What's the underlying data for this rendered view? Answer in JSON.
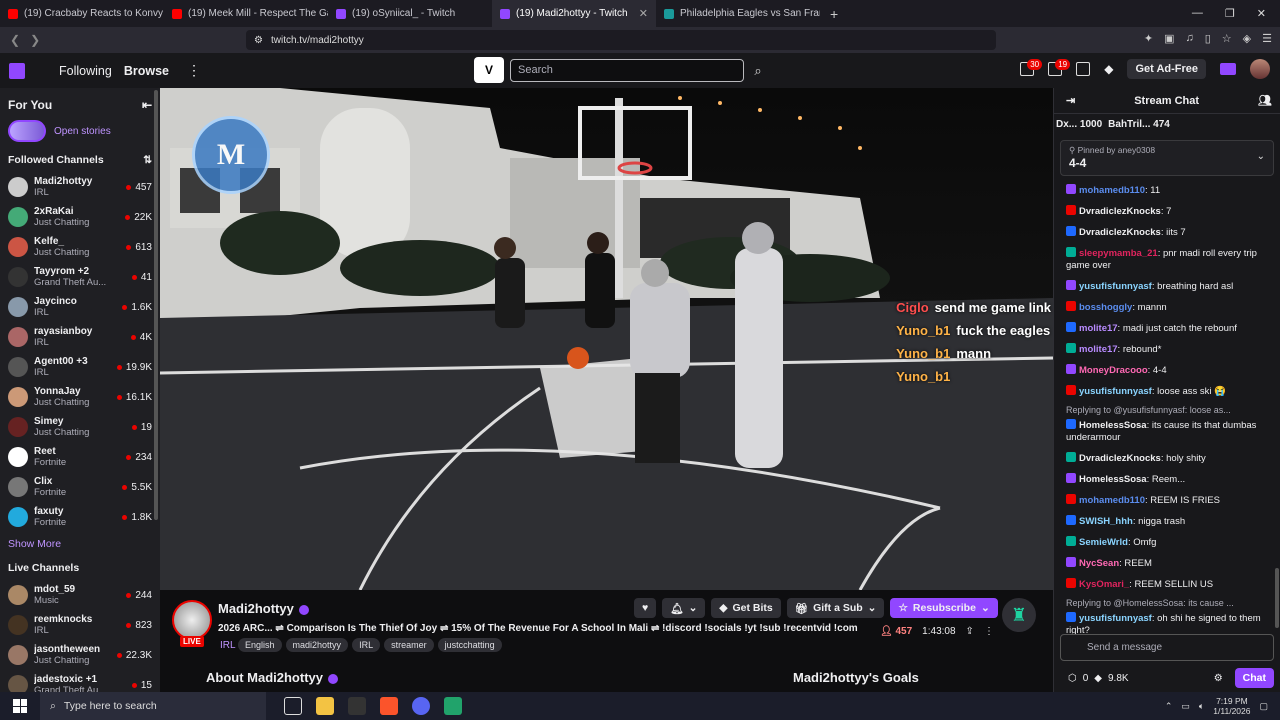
{
  "browser": {
    "tabs": [
      {
        "title": "(19) Cracbaby Reacts to Konvy Nearly...",
        "color": "#ff0000"
      },
      {
        "title": "(19) Meek Mill - Respect The Game [Of...",
        "color": "#ff0000"
      },
      {
        "title": "(19) oSyniical_ - Twitch",
        "color": "#9147ff"
      },
      {
        "title": "(19) Madi2hottyy - Twitch",
        "color": "#9147ff"
      },
      {
        "title": "Philadelphia Eagles vs San Francisco...",
        "color": "#1a9a9a"
      }
    ],
    "active_tab": 3,
    "new_tab": "+",
    "url": "twitch.tv/madi2hottyy"
  },
  "topnav": {
    "following": "Following",
    "browse": "Browse",
    "search_placeholder": "Search",
    "inbox_count": "30",
    "notif_count": "19",
    "ad_free": "Get Ad-Free"
  },
  "sidebar": {
    "for_you": "For You",
    "open_stories": "Open stories",
    "followed_title": "Followed Channels",
    "followed": [
      {
        "name": "Madi2hottyy",
        "game": "IRL",
        "viewers": "457",
        "color": "#ccc"
      },
      {
        "name": "2xRaKai",
        "game": "Just Chatting",
        "viewers": "22K",
        "color": "#4a7"
      },
      {
        "name": "Kelfe_",
        "game": "Just Chatting",
        "viewers": "613",
        "color": "#c54"
      },
      {
        "name": "Tayyrom +2",
        "game": "Grand Theft Au...",
        "viewers": "41",
        "color": "#333"
      },
      {
        "name": "Jaycinco",
        "game": "IRL",
        "viewers": "1.6K",
        "color": "#89a"
      },
      {
        "name": "rayasianboy",
        "game": "IRL",
        "viewers": "4K",
        "color": "#a66"
      },
      {
        "name": "Agent00 +3",
        "game": "IRL",
        "viewers": "19.9K",
        "color": "#555"
      },
      {
        "name": "YonnaJay",
        "game": "Just Chatting",
        "viewers": "16.1K",
        "color": "#c97"
      },
      {
        "name": "Simey",
        "game": "Just Chatting",
        "viewers": "19",
        "color": "#622"
      },
      {
        "name": "Reet",
        "game": "Fortnite",
        "viewers": "234",
        "color": "#fff"
      },
      {
        "name": "Clix",
        "game": "Fortnite",
        "viewers": "5.5K",
        "color": "#777"
      },
      {
        "name": "faxuty",
        "game": "Fortnite",
        "viewers": "1.8K",
        "color": "#2ad"
      }
    ],
    "show_more": "Show More",
    "live_title": "Live Channels",
    "live": [
      {
        "name": "mdot_59",
        "game": "Music",
        "viewers": "244",
        "color": "#a86"
      },
      {
        "name": "reemknocks",
        "game": "IRL",
        "viewers": "823",
        "color": "#432"
      },
      {
        "name": "jasontheween",
        "game": "Just Chatting",
        "viewers": "22.3K",
        "color": "#976"
      },
      {
        "name": "jadestoxic +1",
        "game": "Grand Theft Au...",
        "viewers": "15",
        "color": "#654"
      }
    ]
  },
  "video": {
    "overlay_chat": [
      {
        "user": "Ciglo",
        "msg": "send me game link",
        "red": true
      },
      {
        "user": "Yuno_b1",
        "msg": "fuck the eagles",
        "red": false
      },
      {
        "user": "Yuno_b1",
        "msg": "mann",
        "red": false
      },
      {
        "user": "Yuno_b1",
        "msg": "",
        "red": false
      }
    ]
  },
  "stream": {
    "channel": "Madi2hottyy",
    "live": "LIVE",
    "title": "2026 ARC... ⇌ Comparison Is The Thief Of Joy ⇌ 15% Of The Revenue For A School In Mali ⇌ !discord !socials !yt !sub !recentvid !com",
    "category": "IRL",
    "tags": [
      "English",
      "madi2hottyy",
      "IRL",
      "streamer",
      "justcchatting"
    ],
    "get_bits": "Get Bits",
    "gift_sub": "Gift a Sub",
    "resubscribe": "Resubscribe",
    "viewers": "457",
    "uptime": "1:43:08",
    "about": "About Madi2hottyy",
    "goals": "Madi2hottyy's Goals"
  },
  "chat": {
    "title": "Stream Chat",
    "leaderboard": [
      {
        "name": "Dx...",
        "value": "1000"
      },
      {
        "name": "BahTril...",
        "value": "474"
      }
    ],
    "pinned_by": "Pinned by",
    "pinned_user": "aney0308",
    "pinned_msg": "4-4",
    "messages": [
      {
        "user": "mohamedb110",
        "color": "#5b8def",
        "text": ": 11",
        "reply": ""
      },
      {
        "user": "DvradiclezKnocks",
        "color": "#efeff1",
        "text": ": 7",
        "reply": ""
      },
      {
        "user": "DvradiclezKnocks",
        "color": "#efeff1",
        "text": ": iits 7",
        "reply": ""
      },
      {
        "user": "sleepymamba_21",
        "color": "#e0245e",
        "text": ": pnr madi roll every trip game over",
        "reply": ""
      },
      {
        "user": "yusufisfunnyasf",
        "color": "#8ad4ff",
        "text": ": breathing hard asl",
        "reply": ""
      },
      {
        "user": "bosshoggly",
        "color": "#5b8def",
        "text": ": mannn",
        "reply": ""
      },
      {
        "user": "molite17",
        "color": "#b98bff",
        "text": ": madi just catch the rebounf",
        "reply": ""
      },
      {
        "user": "molite17",
        "color": "#b98bff",
        "text": ": rebound*",
        "reply": ""
      },
      {
        "user": "MoneyDracooo",
        "color": "#ff69b4",
        "text": ": 4-4",
        "reply": ""
      },
      {
        "user": "yusufisfunnyasf",
        "color": "#8ad4ff",
        "text": ": loose ass ski 😭",
        "reply": ""
      },
      {
        "user": "HomelessSosa",
        "color": "#efeff1",
        "text": ": its cause its that dumbas underarmour",
        "reply": "Replying to @yusufisfunnyasf: loose as..."
      },
      {
        "user": "DvradiclezKnocks",
        "color": "#efeff1",
        "text": ": holy shity",
        "reply": ""
      },
      {
        "user": "HomelessSosa",
        "color": "#efeff1",
        "text": ": Reem...",
        "reply": ""
      },
      {
        "user": "mohamedb110",
        "color": "#5b8def",
        "text": ": REEM IS FRIES",
        "reply": ""
      },
      {
        "user": "SWISH_hhh",
        "color": "#8ad4ff",
        "text": ": nigga trash",
        "reply": ""
      },
      {
        "user": "SemieWrld",
        "color": "#8ad4ff",
        "text": ": Omfg",
        "reply": ""
      },
      {
        "user": "NycSean",
        "color": "#ff69b4",
        "text": ": REEM",
        "reply": ""
      },
      {
        "user": "KysOmari_",
        "color": "#e0245e",
        "text": ": REEM SELLIN US",
        "reply": ""
      },
      {
        "user": "yusufisfunnyasf",
        "color": "#8ad4ff",
        "text": ": oh shi he signed to them right?",
        "reply": "Replying to @HomelessSosa: its cause ..."
      }
    ],
    "input_placeholder": "Send a message",
    "points": "0",
    "bits": "9.8K",
    "chat_button": "Chat"
  },
  "taskbar": {
    "search_placeholder": "Type here to search",
    "time": "7:19 PM",
    "date": "1/11/2026"
  }
}
